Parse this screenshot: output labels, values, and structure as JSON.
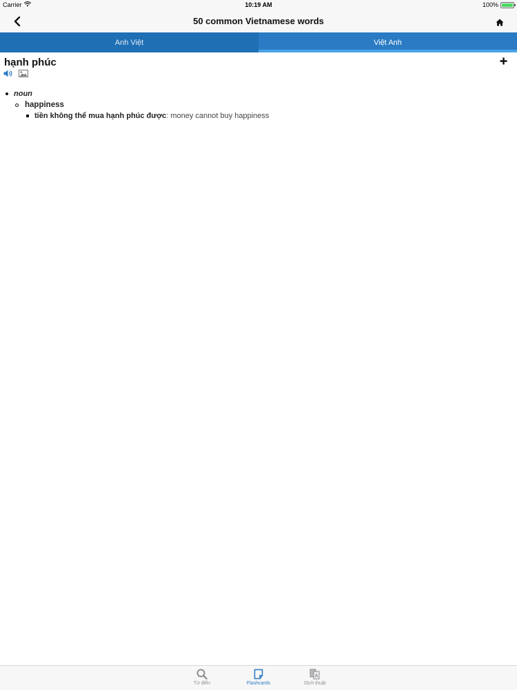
{
  "status": {
    "carrier": "Carrier",
    "time": "10:19 AM",
    "battery": "100%",
    "battery_level": 1.0
  },
  "nav": {
    "title": "50 common Vietnamese words"
  },
  "tabs": [
    {
      "label": "Anh Việt",
      "active": false
    },
    {
      "label": "Việt Anh",
      "active": true
    }
  ],
  "entry": {
    "headword": "hạnh phúc",
    "pos": "noun",
    "sense": "happiness",
    "example_vi": "tiền không thể mua hạnh phúc được",
    "example_sep": ": ",
    "example_en": "money cannot buy happiness"
  },
  "bottom_tabs": [
    {
      "label": "Từ điển",
      "icon": "search-icon",
      "active": false
    },
    {
      "label": "Flashcards",
      "icon": "flashcards-icon",
      "active": true
    },
    {
      "label": "Dịch thuật",
      "icon": "translate-icon",
      "active": false
    }
  ],
  "colors": {
    "accent": "#2a7bc4",
    "tab_bar": "#1f6fb5",
    "tab_indicator": "#4aa3e6"
  }
}
